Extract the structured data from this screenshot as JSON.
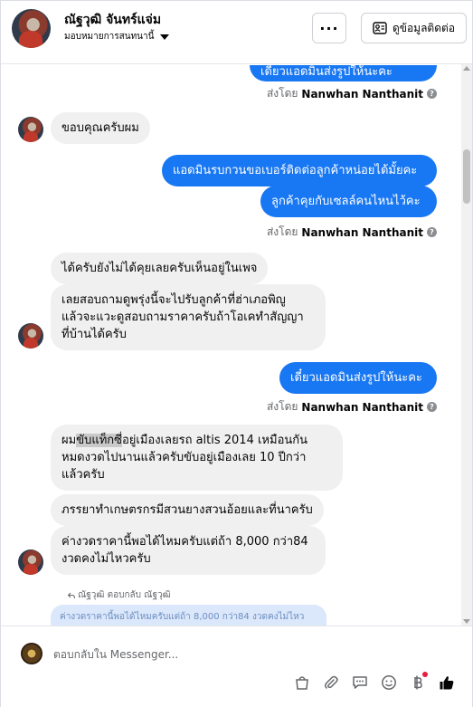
{
  "header": {
    "contact_name": "ณัฐวุฒิ จันทร์แจ่ม",
    "assign_label": "มอบหมายการสนทนานี้",
    "more_label": "···",
    "contact_info_label": "ดูข้อมูลติดต่อ"
  },
  "messages": {
    "top_partial": "เดี๋ยวแอดมินส่งรูปให้นะคะ",
    "sent_by_prefix": "ส่งโดย",
    "sender": "Nanwhan Nanthanit",
    "thanks": "ขอบคุณครับผม",
    "admin_ask_number": "แอดมินรบกวนขอเบอร์ติดต่อลูกค้าหน่อยได้มั้ยคะ",
    "admin_ask_seller": "ลูกค้าคุยกับเซลล์คนไหนไว้คะ",
    "cust_not_talked": "ได้ครับยังไม่ได้คุยเลยครับเห็นอยู่ในเพจ",
    "cust_ask_price_1": "เลยสอบถามดูพรุ่งนี้จะไปรับลูกค้าที่ฮ่าเภอพิญู",
    "cust_ask_price_2": "แล้วจะแวะดูสอบถามราคาครับถ้าโอเคทำสัญญา",
    "cust_ask_price_3": "ที่บ้านได้ครับ",
    "admin_send_pic": "เดี๋ยวแอดมินส่งรูปให้นะคะ",
    "cust_car_1a": "ผม",
    "cust_car_1b": "ขับแท็กซี่",
    "cust_car_1c": "อยู่เมืองเลยรถ altis 2014 เหมือนกัน",
    "cust_car_2": "หมดงวดไปนานแล้วครับขับอยู่เมืองเลย 10 ปีกว่า",
    "cust_car_3": "แล้วครับ",
    "cust_wife": "ภรรยาทำเกษตรกรมีสวนยางสวนอ้อยและที่นาครับ",
    "cust_installment_1": "ค่างวดราคานี้พอได้ไหมครับแต่ถ้า 8,000 กว่า84",
    "cust_installment_2": "งวดคงไม่ไหวครับ",
    "reply_meta": "ณัฐวุฒิ ตอบกลับ ณัฐวุฒิ",
    "reply_quote": "ค่างวดราคานี้พอได้ไหมครับแต่ถ้า 8,000 กว่า84 งวดคงไม่ไหว"
  },
  "composer": {
    "placeholder": "ตอบกลับใน Messenger..."
  },
  "colors": {
    "outgoing": "#1877f2",
    "incoming": "#f0f0f0",
    "like": "#050505"
  }
}
